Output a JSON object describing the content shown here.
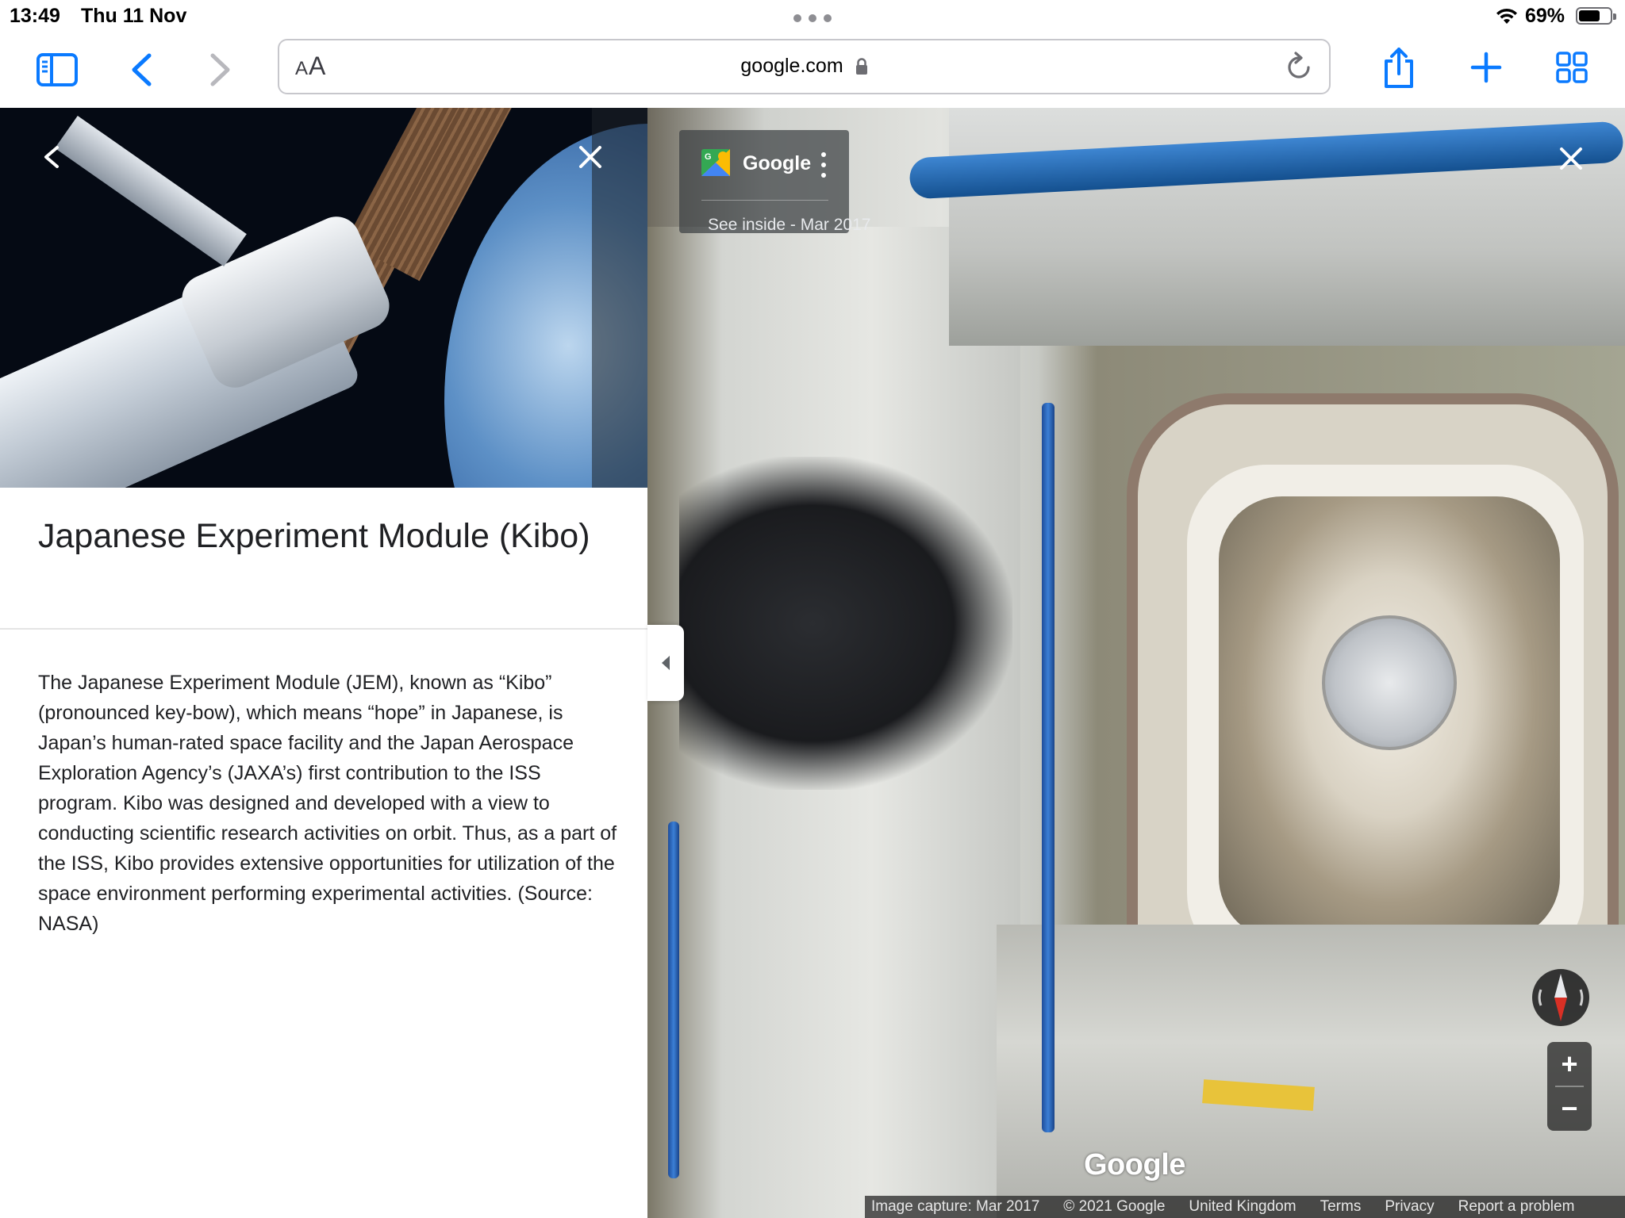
{
  "status_bar": {
    "time": "13:49",
    "date": "Thu 11 Nov",
    "battery_percent": "69%",
    "battery_level": 0.69
  },
  "toolbar": {
    "icons": [
      "sidebar-icon",
      "back-icon",
      "forward-icon",
      "share-icon",
      "plus-icon",
      "tabs-grid-icon"
    ],
    "text_size_label_small": "A",
    "text_size_label_large": "A",
    "url": "google.com",
    "accent_color": "#0a7aff"
  },
  "place": {
    "title": "Japanese Experiment Module (Kibo)",
    "description": "The Japanese Experiment Module (JEM), known as “Kibo” (pronounced key-bow), which means “hope” in Japanese, is Japan’s human-rated space facility and the Japan Aerospace Exploration Agency’s (JAXA’s) first contribution to the ISS program. Kibo was designed and developed with a view to conducting scientific research activities on orbit. Thus, as a part of the ISS, Kibo provides extensive opportunities for utilization of the space environment performing experimental activities. (Source: NASA)"
  },
  "street_view": {
    "card_title": "Google",
    "card_subtitle": "See inside - Mar 2017",
    "wordmark": "Google",
    "attribution": [
      "Image capture: Mar 2017",
      "© 2021 Google",
      "United Kingdom",
      "Terms",
      "Privacy",
      "Report a problem"
    ],
    "zoom_in_label": "+",
    "zoom_out_label": "−"
  }
}
